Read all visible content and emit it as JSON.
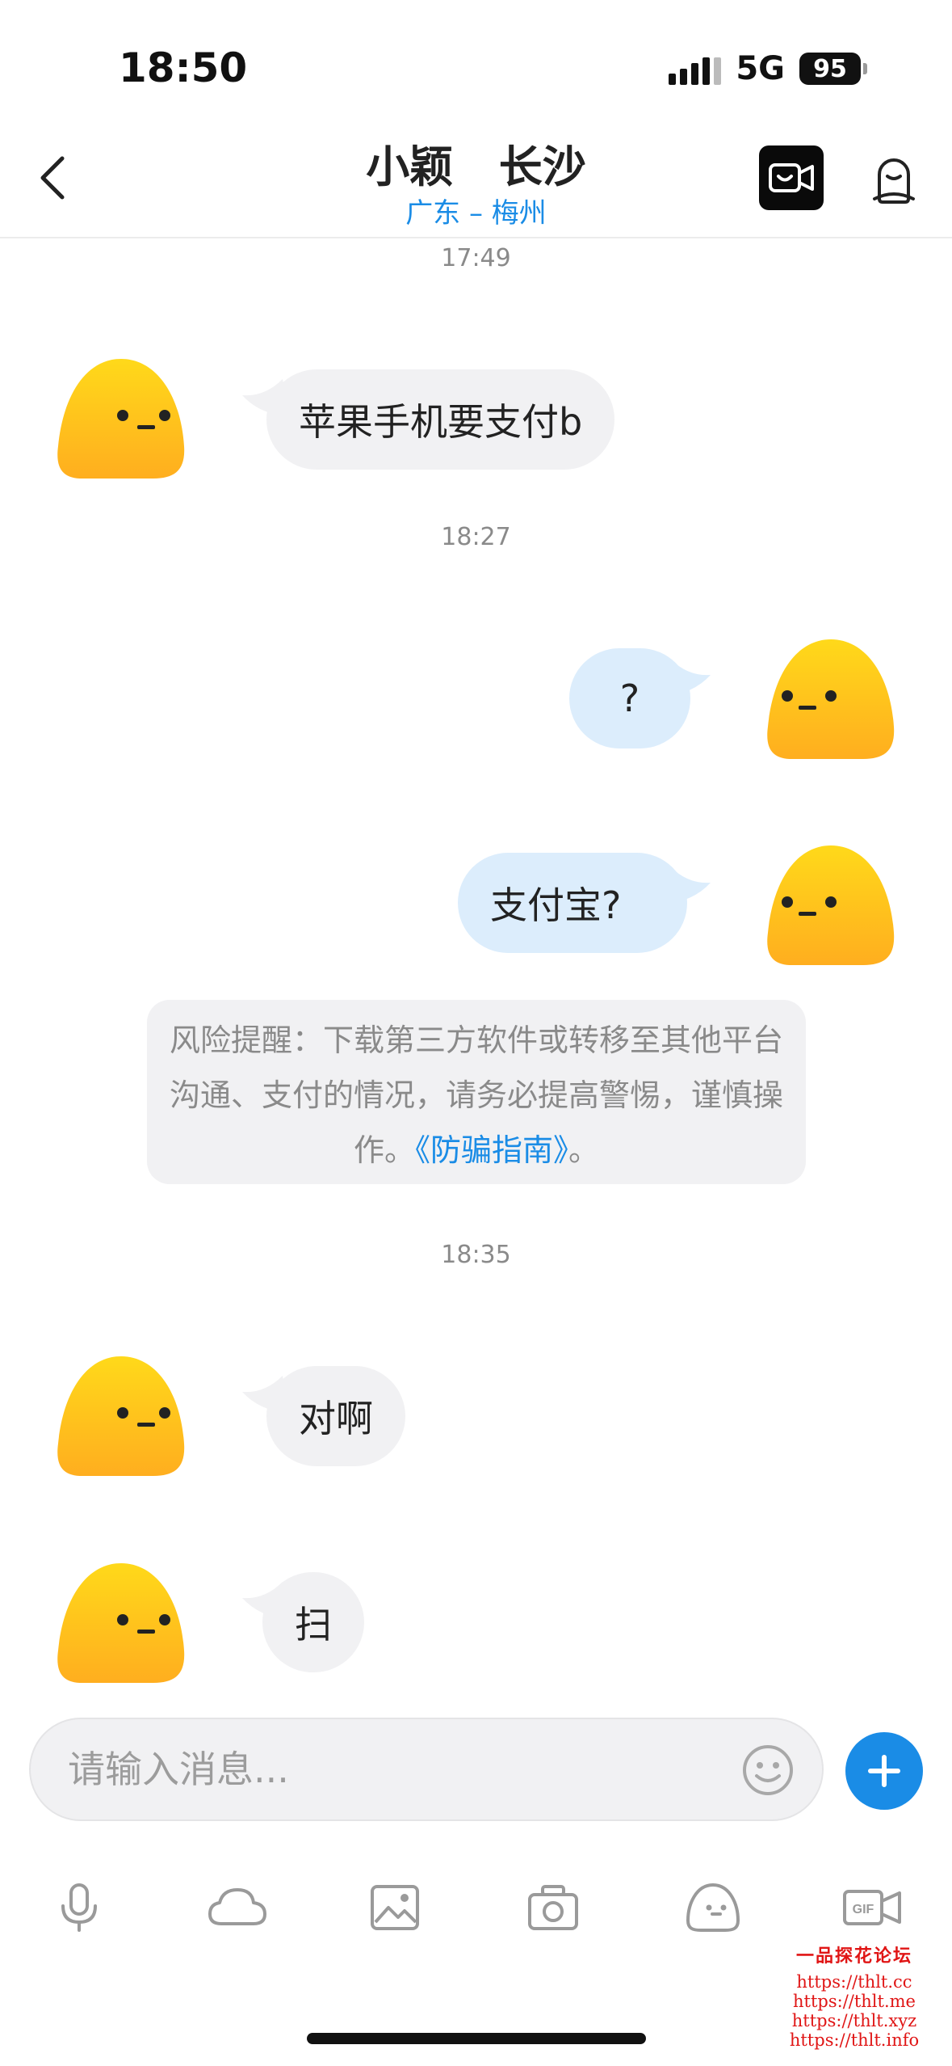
{
  "status_bar": {
    "time": "18:50",
    "network": "5G",
    "battery": "95"
  },
  "header": {
    "title": "小颖   长沙",
    "subtitle": "广东 – 梅州",
    "back_icon": "chevron-left-icon",
    "video_icon": "video-call-icon",
    "profile_icon": "profile-icon"
  },
  "messages": {
    "ts1": "17:49",
    "m1": "苹果手机要支付b",
    "ts2": "18:27",
    "m2": "?",
    "m3": "支付宝?",
    "notice_text": "风险提醒：下载第三方软件或转移至其他平台沟通、支付的情况，请务必提高警惕，谨慎操作。",
    "notice_link": "《防骗指南》",
    "notice_end": "。",
    "ts3": "18:35",
    "m4": "对啊",
    "m5": "扫"
  },
  "input": {
    "placeholder": "请输入消息..."
  },
  "toolbar": [
    "voice-icon",
    "cloud-icon",
    "image-icon",
    "camera-icon",
    "sticker-icon",
    "gif-icon"
  ],
  "watermark": {
    "title": "一品探花论坛",
    "lines": [
      "https://thlt.cc",
      "https://thlt.me",
      "https://thlt.xyz",
      "https://thlt.info"
    ]
  },
  "colors": {
    "accent": "#1a8ce6",
    "incoming_bubble": "#f1f1f3",
    "outgoing_bubble": "#dcedfc",
    "avatar_top": "#ffd91a",
    "avatar_bottom": "#ffae1f"
  }
}
